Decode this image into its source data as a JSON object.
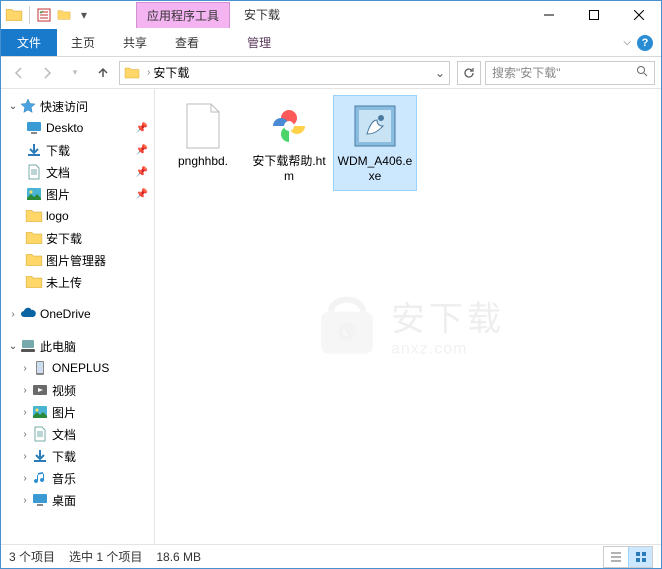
{
  "titlebar": {
    "contextual_tab": "应用程序工具",
    "title": "安下载"
  },
  "ribbon": {
    "file": "文件",
    "tabs": [
      "主页",
      "共享",
      "查看"
    ],
    "contextual": "管理"
  },
  "address": {
    "current": "安下载",
    "search_placeholder": "搜索\"安下载\""
  },
  "nav": {
    "quick_access": "快速访问",
    "qa_items": [
      {
        "label": "Deskto",
        "icon": "desktop",
        "pinned": true
      },
      {
        "label": "下载",
        "icon": "download",
        "pinned": true
      },
      {
        "label": "文档",
        "icon": "document",
        "pinned": true
      },
      {
        "label": "图片",
        "icon": "pictures",
        "pinned": true
      },
      {
        "label": "logo",
        "icon": "folder",
        "pinned": false
      },
      {
        "label": "安下载",
        "icon": "folder",
        "pinned": false
      },
      {
        "label": "图片管理器",
        "icon": "folder",
        "pinned": false
      },
      {
        "label": "未上传",
        "icon": "folder",
        "pinned": false
      }
    ],
    "onedrive": "OneDrive",
    "this_pc": "此电脑",
    "pc_items": [
      {
        "label": "ONEPLUS",
        "icon": "phone"
      },
      {
        "label": "视频",
        "icon": "video"
      },
      {
        "label": "图片",
        "icon": "pictures"
      },
      {
        "label": "文档",
        "icon": "document"
      },
      {
        "label": "下载",
        "icon": "download"
      },
      {
        "label": "音乐",
        "icon": "music"
      },
      {
        "label": "桌面",
        "icon": "desktop"
      }
    ]
  },
  "items": [
    {
      "name": "pnghhbd.",
      "type": "file",
      "selected": false
    },
    {
      "name": "安下载帮助.htm",
      "type": "htm",
      "selected": false
    },
    {
      "name": "WDM_A406.exe",
      "type": "exe",
      "selected": true
    }
  ],
  "status": {
    "count": "3 个项目",
    "selection": "选中 1 个项目",
    "size": "18.6 MB"
  },
  "watermark": {
    "title": "安下载",
    "sub": "anxz.com"
  }
}
